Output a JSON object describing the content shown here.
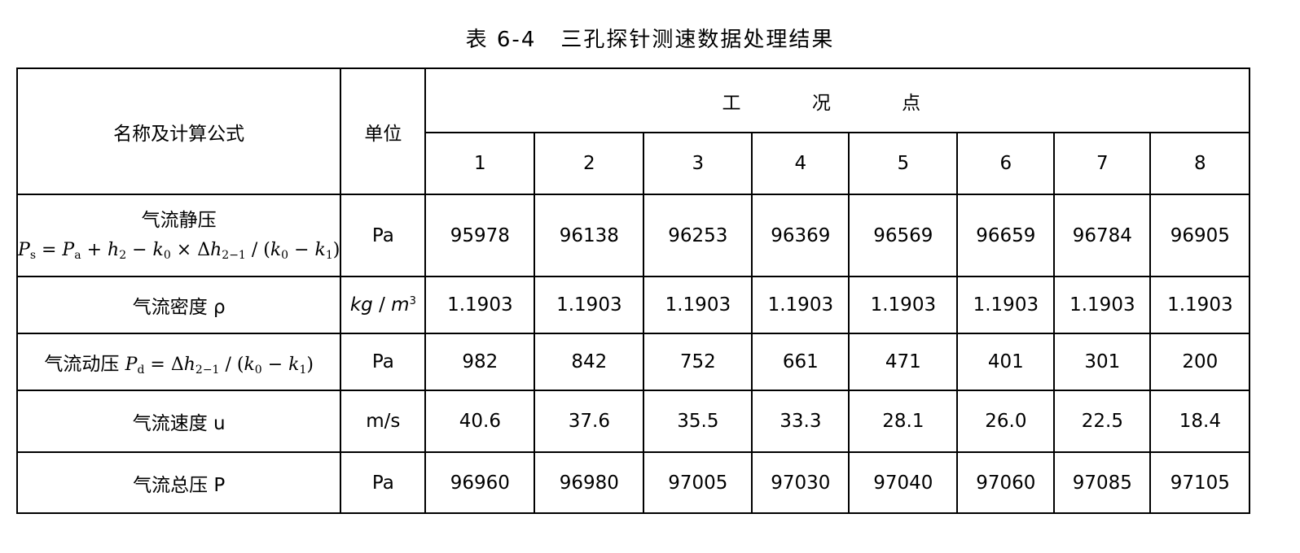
{
  "caption": {
    "number": "表 6-4",
    "title": "三孔探针测速数据处理结果"
  },
  "header": {
    "name_col": "名称及计算公式",
    "unit_col": "单位",
    "group": "工 况 点",
    "points": [
      "1",
      "2",
      "3",
      "4",
      "5",
      "6",
      "7",
      "8"
    ]
  },
  "rows": [
    {
      "label": "气流静压",
      "formula": "Ps = Pa + h2 − k0 × Δh2−1 / (k0 − k1)",
      "unit": "Pa",
      "values": [
        "95978",
        "96138",
        "96253",
        "96369",
        "96569",
        "96659",
        "96784",
        "96905"
      ]
    },
    {
      "label": "气流密度 ρ",
      "unit": "kg / m3",
      "values": [
        "1.1903",
        "1.1903",
        "1.1903",
        "1.1903",
        "1.1903",
        "1.1903",
        "1.1903",
        "1.1903"
      ]
    },
    {
      "label": "气流动压",
      "formula": "Pd = Δh2−1 / (k0 − k1)",
      "unit": "Pa",
      "values": [
        "982",
        "842",
        "752",
        "661",
        "471",
        "401",
        "301",
        "200"
      ]
    },
    {
      "label": "气流速度 u",
      "unit": "m/s",
      "values": [
        "40.6",
        "37.6",
        "35.5",
        "33.3",
        "28.1",
        "26.0",
        "22.5",
        "18.4"
      ]
    },
    {
      "label": "气流总压 P",
      "unit": "Pa",
      "values": [
        "96960",
        "96980",
        "97005",
        "97030",
        "97040",
        "97060",
        "97085",
        "97105"
      ]
    }
  ]
}
